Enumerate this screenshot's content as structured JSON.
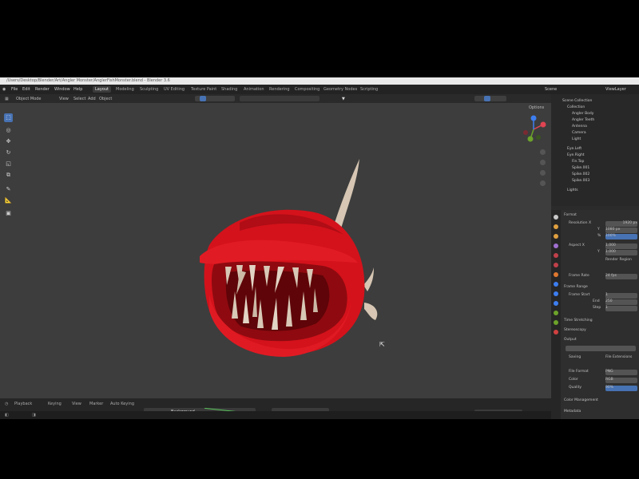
{
  "window": {
    "title": "/Users/Desktop/Blender/Art/Angler Monster/AnglerFishMonster.blend - Blender 3.6"
  },
  "menu": [
    "File",
    "Edit",
    "Render",
    "Window",
    "Help"
  ],
  "workspaces": [
    "Layout",
    "Modeling",
    "Sculpting",
    "UV Editing",
    "Texture Paint",
    "Shading",
    "Animation",
    "Rendering",
    "Compositing",
    "Geometry Nodes",
    "Scripting"
  ],
  "scene": {
    "label": "Scene",
    "view_layer": "ViewLayer"
  },
  "viewport_header": [
    "Object Mode",
    "View",
    "Select",
    "Add",
    "Object"
  ],
  "viewport": {
    "options": "Options"
  },
  "toolbar": [
    "select",
    "cursor",
    "move",
    "rotate",
    "scale",
    "transform",
    "annotate",
    "measure",
    "add-cube"
  ],
  "outliner": {
    "rows": [
      "Scene Collection",
      "Collection",
      "Angler Body",
      "Angler Teeth",
      "Antenna",
      "Camera",
      "Light",
      "Eye.Left",
      "Eye.Right",
      "Fin.Top",
      "Spike.001",
      "Spike.002",
      "Spike.003",
      "Lights"
    ]
  },
  "properties": {
    "rows": [
      {
        "label": "Format",
        "value": ""
      },
      {
        "label": "Resolution X",
        "value": "1920 px"
      },
      {
        "label": "Y",
        "value": "1080 px"
      },
      {
        "label": "%",
        "value": "100%"
      },
      {
        "label": "Aspect X",
        "value": "1.000"
      },
      {
        "label": "Y",
        "value": "1.000"
      },
      {
        "label": "Render Region",
        "value": ""
      },
      {
        "label": "Frame Rate",
        "value": "24 fps"
      },
      {
        "label": "Frame Range",
        "value": ""
      },
      {
        "label": "Frame Start",
        "value": "1"
      },
      {
        "label": "End",
        "value": "250"
      },
      {
        "label": "Step",
        "value": "1"
      },
      {
        "label": "Time Stretching",
        "value": ""
      },
      {
        "label": "Stereoscopy",
        "value": ""
      },
      {
        "label": "Output",
        "value": ""
      },
      {
        "label": "Saving",
        "value": "File Extensions"
      },
      {
        "label": "File Format",
        "value": "PNG"
      },
      {
        "label": "Color",
        "value": "RGB"
      },
      {
        "label": "Quality",
        "value": "90%"
      },
      {
        "label": "Color Management",
        "value": ""
      },
      {
        "label": "Metadata",
        "value": ""
      }
    ]
  },
  "timeline": [
    "Playback",
    "Keying",
    "View",
    "Marker",
    "Auto Keying"
  ],
  "node_panel": {
    "label": "Background"
  },
  "colors": {
    "accent": "#4772b3",
    "model_red": "#d7121b",
    "teeth": "#d8c8b6"
  }
}
